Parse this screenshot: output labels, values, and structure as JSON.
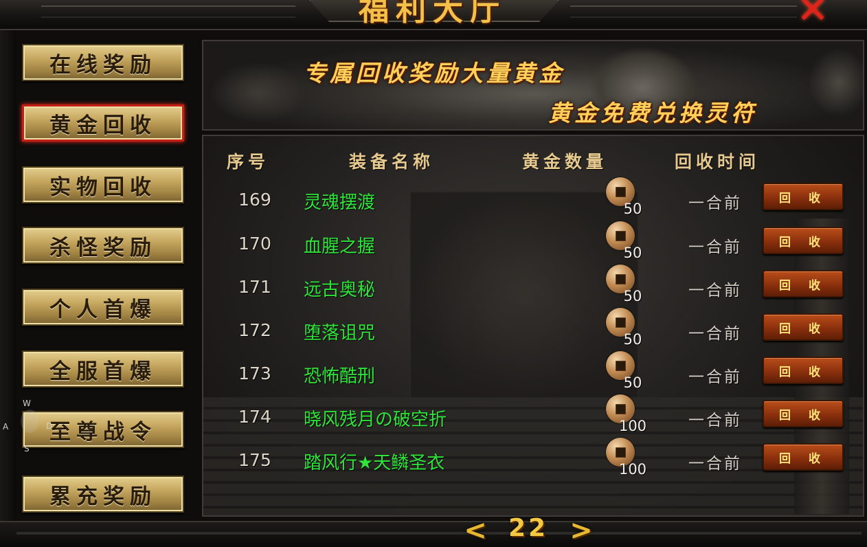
{
  "header": {
    "title": "福利大厅"
  },
  "sidebar": {
    "items": [
      {
        "label": "在线奖励"
      },
      {
        "label": "黄金回收",
        "active": true
      },
      {
        "label": "实物回收"
      },
      {
        "label": "杀怪奖励"
      },
      {
        "label": "个人首爆"
      },
      {
        "label": "全服首爆"
      },
      {
        "label": "至尊战令"
      },
      {
        "label": "累充奖励"
      }
    ]
  },
  "controls": {
    "w": "W",
    "a": "A",
    "s": "S",
    "d": "D"
  },
  "banner": {
    "line1": "专属回收奖励大量黄金",
    "line2": "黄金免费兑换灵符"
  },
  "table": {
    "headers": {
      "num": "序号",
      "name": "装备名称",
      "gold": "黄金数量",
      "time": "回收时间"
    },
    "rows": [
      {
        "num": "169",
        "name": "灵魂摆渡",
        "gold": "50",
        "time": "一合前",
        "action": "回 收"
      },
      {
        "num": "170",
        "name": "血腥之握",
        "gold": "50",
        "time": "一合前",
        "action": "回 收"
      },
      {
        "num": "171",
        "name": "远古奥秘",
        "gold": "50",
        "time": "一合前",
        "action": "回 收"
      },
      {
        "num": "172",
        "name": "堕落诅咒",
        "gold": "50",
        "time": "一合前",
        "action": "回 收"
      },
      {
        "num": "173",
        "name": "恐怖酷刑",
        "gold": "50",
        "time": "一合前",
        "action": "回 收"
      },
      {
        "num": "174",
        "name": "晓风残月の破空折",
        "gold": "100",
        "time": "一合前",
        "action": "回 收"
      },
      {
        "num": "175",
        "name": "踏风行★天鳞圣衣",
        "gold": "100",
        "time": "一合前",
        "action": "回 收"
      }
    ]
  },
  "pager": {
    "page": "22",
    "prev": "<",
    "next": ">"
  },
  "colors": {
    "accent_gold": "#f3c14a",
    "item_green": "#2fe43a",
    "button_red": "#8a300d"
  }
}
